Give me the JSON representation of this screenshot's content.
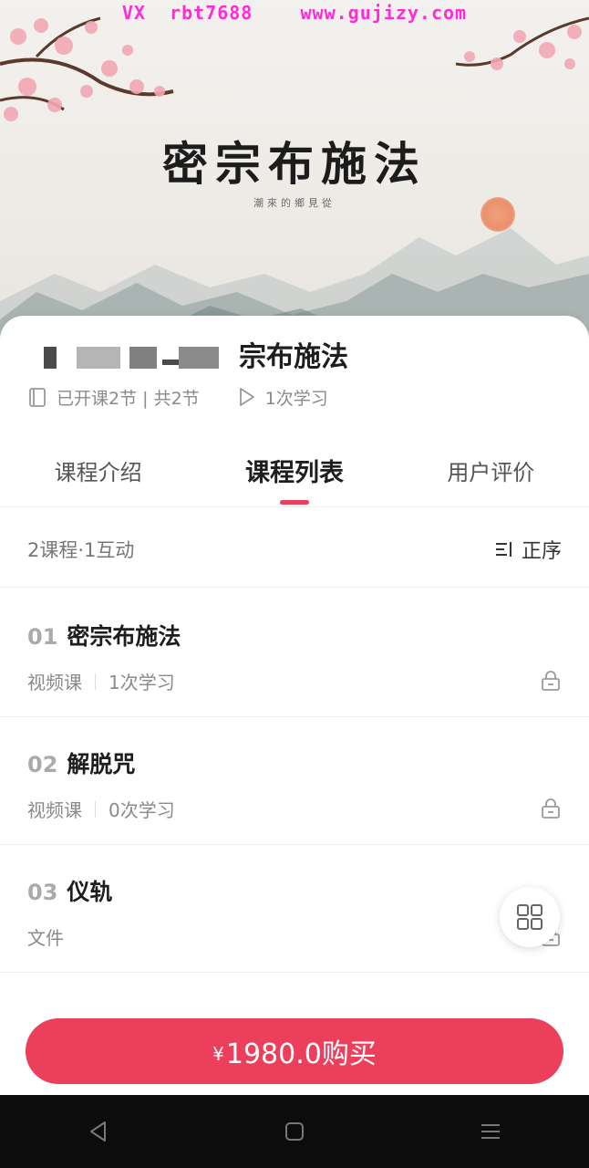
{
  "watermark": "VX  rbt7688    www.gujizy.com",
  "hero": {
    "title": "密宗布施法",
    "subtitle": "潮來的鄉見從"
  },
  "course": {
    "title": "宗布施法",
    "progress_text": "已开课2节 | 共2节",
    "study_count": "1次学习"
  },
  "tabs": [
    {
      "label": "课程介绍",
      "active": false
    },
    {
      "label": "课程列表",
      "active": true
    },
    {
      "label": "用户评价",
      "active": false
    }
  ],
  "list": {
    "summary": "2课程·1互动",
    "sort_label": "正序",
    "sort_icon": "sort-icon"
  },
  "lessons": [
    {
      "num": "01",
      "title": "密宗布施法",
      "type": "视频课",
      "count": "1次学习",
      "locked": true
    },
    {
      "num": "02",
      "title": "解脱咒",
      "type": "视频课",
      "count": "0次学习",
      "locked": true
    },
    {
      "num": "03",
      "title": "仪轨",
      "type": "文件",
      "count": "",
      "locked": true
    }
  ],
  "buy": {
    "currency": "¥",
    "label": "1980.0购买"
  },
  "colors": {
    "accent": "#ec3f5c",
    "watermark": "#ff2bd6",
    "navbar": "#0c0c0c"
  }
}
